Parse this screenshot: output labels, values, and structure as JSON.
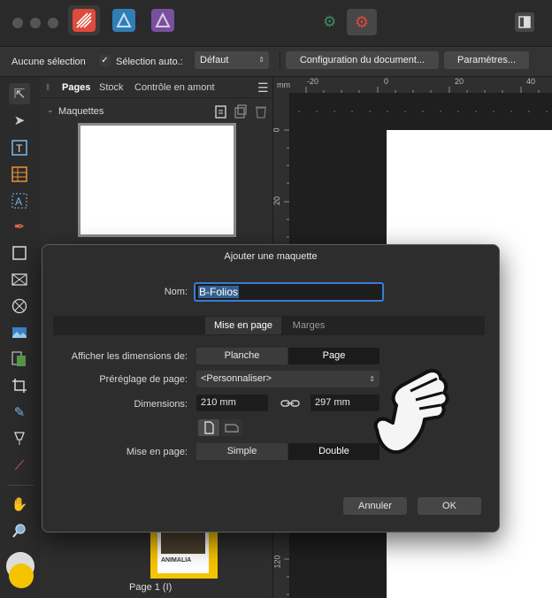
{
  "context_bar": {
    "selection_status": "Aucune sélection",
    "auto_select_label": "Sélection auto.:",
    "auto_select_value": "Défaut",
    "document_setup_label": "Configuration du document...",
    "settings_label": "Paramètres..."
  },
  "panel": {
    "tabs": [
      "Pages",
      "Stock",
      "Contrôle en amont"
    ],
    "section_title": "Maquettes",
    "page_label": "Page 1 (I)",
    "thumbnail_text": "ANIMALIA"
  },
  "ruler": {
    "unit": "mm",
    "h_ticks": [
      "-20",
      "0",
      "20",
      "40"
    ],
    "v_ticks": [
      "0",
      "20",
      "120"
    ]
  },
  "dialog": {
    "title": "Ajouter une maquette",
    "name_label": "Nom:",
    "name_value": "B-Folios",
    "tabs": [
      "Mise en page",
      "Marges"
    ],
    "show_dimensions_label": "Afficher les dimensions de:",
    "show_dimensions_options": [
      "Planche",
      "Page"
    ],
    "preset_label": "Préréglage de page:",
    "preset_value": "<Personnaliser>",
    "dimensions_label": "Dimensions:",
    "width_value": "210 mm",
    "height_value": "297 mm",
    "layout_label": "Mise en page:",
    "layout_options": [
      "Simple",
      "Double"
    ],
    "cancel_label": "Annuler",
    "ok_label": "OK"
  },
  "colors": {
    "accent_blue": "#3a7bd5",
    "publisher_red": "#e04a3b",
    "designer_blue": "#2e7fb8",
    "photo_purple": "#7a4fa0",
    "swatch_yellow": "#f5c400"
  }
}
